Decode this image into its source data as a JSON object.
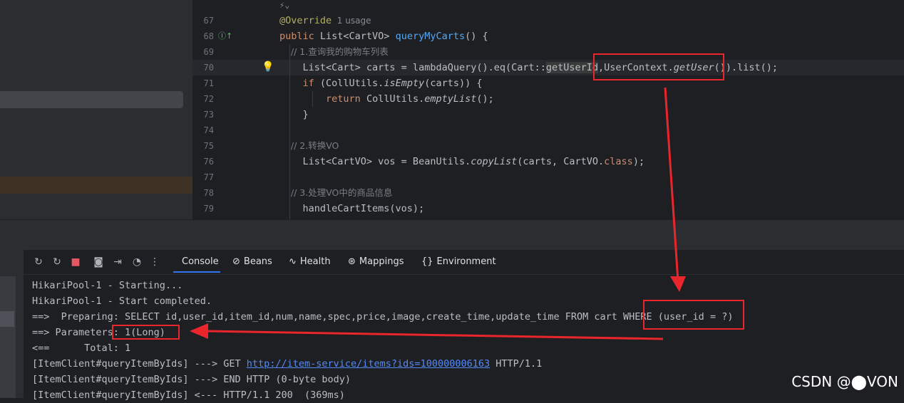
{
  "editor": {
    "top_hint": "⚡⌄",
    "lines": [
      {
        "num": "67",
        "parts": [
          {
            "t": "@Override",
            "c": "ann"
          },
          {
            "t": "  1 usage",
            "c": "hint"
          }
        ]
      },
      {
        "num": "68",
        "parts": [
          {
            "t": "public ",
            "c": "kw"
          },
          {
            "t": "List<CartVO> "
          },
          {
            "t": "queryMyCarts",
            "c": "fn"
          },
          {
            "t": "() {"
          }
        ]
      },
      {
        "num": "69",
        "parts": [
          {
            "t": "    // 1.查询我的购物车列表",
            "c": "cm"
          }
        ]
      },
      {
        "num": "70",
        "current": true,
        "parts": [
          {
            "t": "    List<Cart> carts = lambdaQuery().eq(Cart::"
          },
          {
            "t": "getUserId",
            "c": "hlref"
          },
          {
            "t": ",UserContext."
          },
          {
            "t": "getUser",
            "c": "it"
          },
          {
            "t": "()).list();"
          }
        ]
      },
      {
        "num": "71",
        "parts": [
          {
            "t": "    "
          },
          {
            "t": "if ",
            "c": "kw"
          },
          {
            "t": "(CollUtils."
          },
          {
            "t": "isEmpty",
            "c": "it"
          },
          {
            "t": "(carts)) {"
          }
        ]
      },
      {
        "num": "72",
        "parts": [
          {
            "t": "        "
          },
          {
            "t": "return ",
            "c": "kw"
          },
          {
            "t": "CollUtils."
          },
          {
            "t": "emptyList",
            "c": "it"
          },
          {
            "t": "();"
          }
        ]
      },
      {
        "num": "73",
        "parts": [
          {
            "t": "    }"
          }
        ]
      },
      {
        "num": "74",
        "parts": []
      },
      {
        "num": "75",
        "parts": [
          {
            "t": "    // 2.转换VO",
            "c": "cm"
          }
        ]
      },
      {
        "num": "76",
        "parts": [
          {
            "t": "    List<CartVO> vos = BeanUtils."
          },
          {
            "t": "copyList",
            "c": "it"
          },
          {
            "t": "(carts, CartVO."
          },
          {
            "t": "class",
            "c": "kw"
          },
          {
            "t": ");"
          }
        ]
      },
      {
        "num": "77",
        "parts": []
      },
      {
        "num": "78",
        "parts": [
          {
            "t": "    // 3.处理VO中的商品信息",
            "c": "cm"
          }
        ]
      },
      {
        "num": "79",
        "parts": [
          {
            "t": "    handleCartItems(vos);"
          }
        ]
      }
    ]
  },
  "toolbar": {
    "tabs": [
      {
        "label": "Console",
        "icon": ""
      },
      {
        "label": "Beans",
        "icon": "⊘"
      },
      {
        "label": "Health",
        "icon": "∿"
      },
      {
        "label": "Mappings",
        "icon": "⊛"
      },
      {
        "label": "Environment",
        "icon": "{}"
      }
    ]
  },
  "console": {
    "lines": [
      {
        "text": "HikariPool-1 - Starting..."
      },
      {
        "text": "HikariPool-1 - Start completed."
      },
      {
        "text": "==>  Preparing: SELECT id,user_id,item_id,num,name,spec,price,image,create_time,update_time FROM cart WHERE (user_id = ?)"
      },
      {
        "text": "==> Parameters: 1(Long)"
      },
      {
        "text": "<==      Total: 1"
      },
      {
        "pre": "[ItemClient#queryItemByIds] ---> GET ",
        "link": "http://item-service/items?ids=100000006163",
        "post": " HTTP/1.1"
      },
      {
        "text": "[ItemClient#queryItemByIds] ---> END HTTP (0-byte body)"
      },
      {
        "text": "[ItemClient#queryItemByIds] <--- HTTP/1.1 200  (369ms)"
      }
    ]
  },
  "watermark": "CSDN @⬤VON",
  "colors": {
    "annotation_red": "#e8262c",
    "accent": "#3574f0"
  }
}
